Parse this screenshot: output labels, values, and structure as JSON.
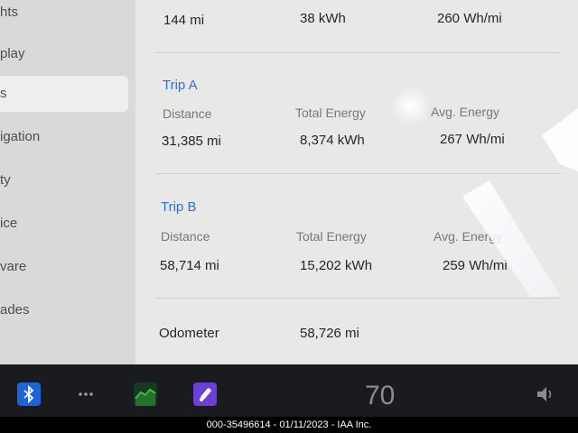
{
  "sidebar": {
    "items": [
      {
        "label": "hts"
      },
      {
        "label": "play"
      },
      {
        "label": "s"
      },
      {
        "label": "igation"
      },
      {
        "label": "ty"
      },
      {
        "label": "ice"
      },
      {
        "label": "vare"
      },
      {
        "label": "ades"
      }
    ]
  },
  "since_last_charge": {
    "distance": "144 mi",
    "total_energy": "38 kWh",
    "avg_energy": "260 Wh/mi"
  },
  "trip_a": {
    "title": "Trip A",
    "headers": {
      "distance": "Distance",
      "total_energy": "Total Energy",
      "avg_energy": "Avg. Energy"
    },
    "distance": "31,385 mi",
    "total_energy": "8,374 kWh",
    "avg_energy": "267 Wh/mi"
  },
  "trip_b": {
    "title": "Trip B",
    "headers": {
      "distance": "Distance",
      "total_energy": "Total Energy",
      "avg_energy": "Avg. Energy"
    },
    "distance": "58,714 mi",
    "total_energy": "15,202 kWh",
    "avg_energy": "259 Wh/mi"
  },
  "odometer": {
    "label": "Odometer",
    "value": "58,726 mi"
  },
  "taskbar": {
    "icons": [
      "bluetooth-icon",
      "more-dots-icon",
      "energy-graph-icon",
      "toybox-icon"
    ],
    "speed": "70",
    "volume_icon": "volume-icon"
  },
  "caption": "000-35496614 - 01/11/2023 - IAA Inc.",
  "colors": {
    "accent": "#2f6fd6",
    "taskbar": "#1a1b1e"
  }
}
